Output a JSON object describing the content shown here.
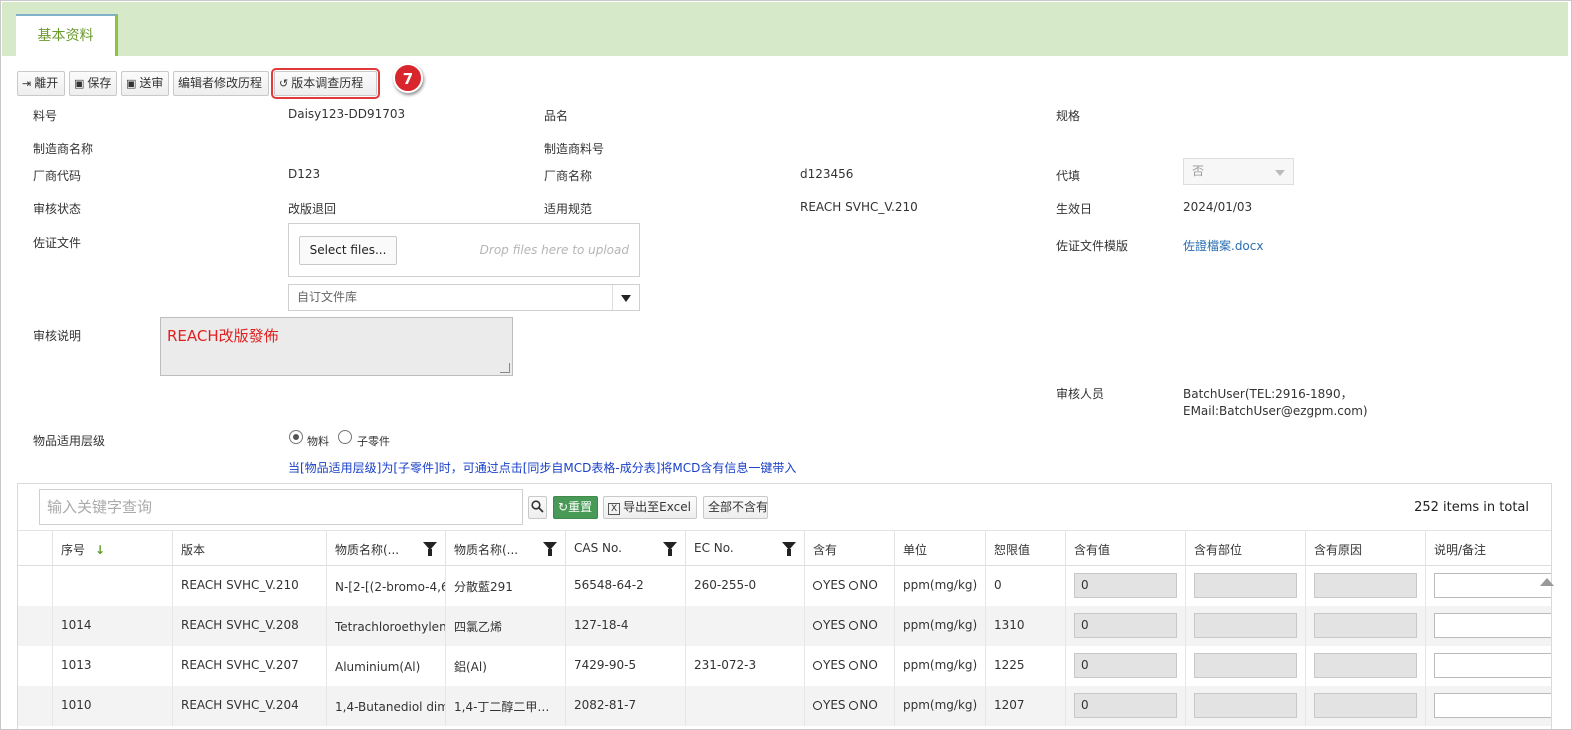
{
  "tab": {
    "label": "基本资料"
  },
  "toolbar": {
    "leave": "離开",
    "save": "保存",
    "submit": "送审",
    "editor_history": "编辑者修改历程",
    "version_history": "版本调查历程",
    "step_badge": "7"
  },
  "form": {
    "part_no_label": "料号",
    "part_no": "Daisy123-DD91703",
    "product_name_label": "品名",
    "spec_label": "规格",
    "mfr_name_label": "制造商名称",
    "mfr_part_label": "制造商料号",
    "vendor_code_label": "厂商代码",
    "vendor_code": "D123",
    "vendor_name_label": "厂商名称",
    "vendor_name": "d123456",
    "fill_on_behalf_label": "代填",
    "fill_on_behalf": "否",
    "review_status_label": "审核状态",
    "review_status": "改版退回",
    "regulation_label": "适用规范",
    "regulation": "REACH SVHC_V.210",
    "effective_date_label": "生效日",
    "effective_date": "2024/01/03",
    "evidence_label": "佐证文件",
    "select_files": "Select files...",
    "drop_hint": "Drop files here to upload",
    "custom_library": "自订文件库",
    "evidence_template_label": "佐证文件模版",
    "evidence_template": "佐證檔案.docx",
    "review_note_label": "审核说明",
    "review_note": "REACH改版發佈",
    "reviewer_label": "审核人员",
    "reviewer_line1": "BatchUser(TEL:2916-1890，",
    "reviewer_line2": "EMail:BatchUser@ezgpm.com)",
    "level_label": "物品适用层级",
    "level_opt_material": "物料",
    "level_opt_subpart": "子零件",
    "level_selected": "物料",
    "level_note": "当[物品适用层级]为[子零件]时，可通过点击[同步自MCD表格-成分表]将MCD含有信息一键带入"
  },
  "grid": {
    "search_placeholder": "输入关键字查询",
    "reset": "重置",
    "export": "导出至Excel",
    "none_contained": "全部不含有",
    "total": "252 items in total",
    "columns": [
      "序号",
      "版本",
      "物质名称(...",
      "物质名称(...",
      "CAS No.",
      "EC No.",
      "含有",
      "单位",
      "恕限值",
      "含有值",
      "含有部位",
      "含有原因",
      "说明/备注"
    ],
    "rows": [
      {
        "seq": "",
        "version": "REACH SVHC_V.210",
        "name_en": "N-[2-[(2-bromo-4,6-",
        "name_zh": "分散藍291",
        "cas": "56548-64-2",
        "ec": "260-255-0",
        "yes": "YES",
        "no": "NO",
        "unit": "ppm(mg/kg)",
        "threshold": "0",
        "content": "0"
      },
      {
        "seq": "1014",
        "version": "REACH SVHC_V.208",
        "name_en": "Tetrachloroethylene",
        "name_zh": "四氯乙烯",
        "cas": "127-18-4",
        "ec": "",
        "yes": "YES",
        "no": "NO",
        "unit": "ppm(mg/kg)",
        "threshold": "1310",
        "content": "0"
      },
      {
        "seq": "1013",
        "version": "REACH SVHC_V.207",
        "name_en": "Aluminium(Al)",
        "name_zh": "鋁(Al)",
        "cas": "7429-90-5",
        "ec": "231-072-3",
        "yes": "YES",
        "no": "NO",
        "unit": "ppm(mg/kg)",
        "threshold": "1225",
        "content": "0"
      },
      {
        "seq": "1010",
        "version": "REACH SVHC_V.204",
        "name_en": "1,4-Butanediol dim",
        "name_zh": "1,4-丁二醇二甲…",
        "cas": "2082-81-7",
        "ec": "",
        "yes": "YES",
        "no": "NO",
        "unit": "ppm(mg/kg)",
        "threshold": "1207",
        "content": "0"
      }
    ]
  }
}
